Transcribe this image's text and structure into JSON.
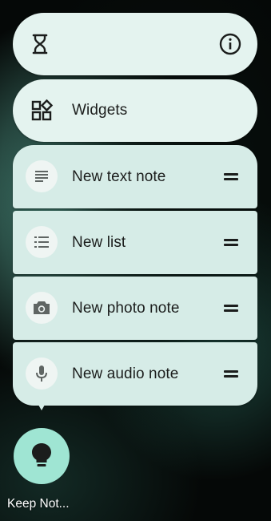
{
  "top_bar": {
    "hourglass_icon": "hourglass-icon",
    "info_icon": "info-icon"
  },
  "widgets": {
    "label": "Widgets",
    "icon": "widgets-icon"
  },
  "shortcuts": [
    {
      "label": "New text note",
      "icon": "text-note-icon"
    },
    {
      "label": "New list",
      "icon": "list-icon"
    },
    {
      "label": "New photo note",
      "icon": "camera-icon"
    },
    {
      "label": "New audio note",
      "icon": "microphone-icon"
    }
  ],
  "app": {
    "name": "Keep Not...",
    "icon": "lightbulb-icon",
    "icon_color": "#9fe5d3"
  },
  "colors": {
    "card_bg": "#d6ece7",
    "card_light_bg": "#e4f3ef",
    "icon_circle_bg": "#eff5f3"
  }
}
